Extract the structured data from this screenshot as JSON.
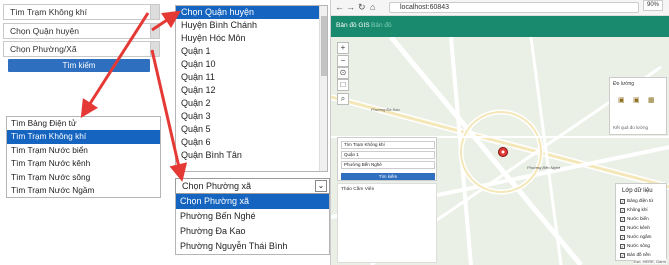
{
  "panel_a": {
    "fields": [
      "Tìm Trạm Không khí",
      "Chọn Quận huyện",
      "Chọn Phường/Xã"
    ],
    "search_button": "Tìm kiếm"
  },
  "panel_b": {
    "options": [
      "Tìm Bảng Điện tử",
      "Tìm Trạm Không khí",
      "Tìm Trạm Nước biển",
      "Tìm Trạm Nước kênh",
      "Tìm Trạm Nước sông",
      "Tìm Trạm Nước Ngầm"
    ],
    "selected_index": 1
  },
  "panel_c": {
    "options": [
      "Chọn Quận huyện",
      "Huyện Bình Chánh",
      "Huyện Hóc Môn",
      "Quận 1",
      "Quận 10",
      "Quận 11",
      "Quận 12",
      "Quận 2",
      "Quận 3",
      "Quận 5",
      "Quận 6",
      "Quận Bình Tân"
    ],
    "selected_index": 0
  },
  "panel_d": {
    "select_value": "Chọn Phường xã",
    "options": [
      "Chọn Phường xã",
      "Phường Bến Nghé",
      "Phường Đa Kao",
      "Phường Nguyễn Thái Bình"
    ],
    "selected_index": 0
  },
  "browser": {
    "url": "localhost:60843",
    "zoom": "90%",
    "nav_title": "Bản đồ GIS",
    "nav_secondary": "Bản đồ",
    "map_controls": [
      "+",
      "−",
      "⊙",
      "□",
      "⌕"
    ],
    "measure": {
      "title": "Đo lường",
      "result": "Kết quả đo lường"
    },
    "form": {
      "fields": [
        "Tìm Trạm Không khí",
        "Quận 1",
        "Phường Bến Nghé"
      ],
      "button": "Tìm kiếm",
      "result": "Thảo Cầm Viên"
    },
    "layers": {
      "title": "Lớp dữ liệu",
      "items": [
        "Bảng điện tử",
        "Không khí",
        "Nước biển",
        "Nước kênh",
        "Nước ngầm",
        "Nước sông",
        "Bản đồ nền"
      ]
    },
    "map_labels": [
      "Phường Đa Kao",
      "Phường Bến Nghé"
    ],
    "attribution": "Esri, HERE, Garm"
  },
  "colors": {
    "selected_blue": "#1565c0",
    "button_blue": "#2e6fbf",
    "nav_green": "#1a8a6e",
    "arrow_red": "#e53935"
  }
}
